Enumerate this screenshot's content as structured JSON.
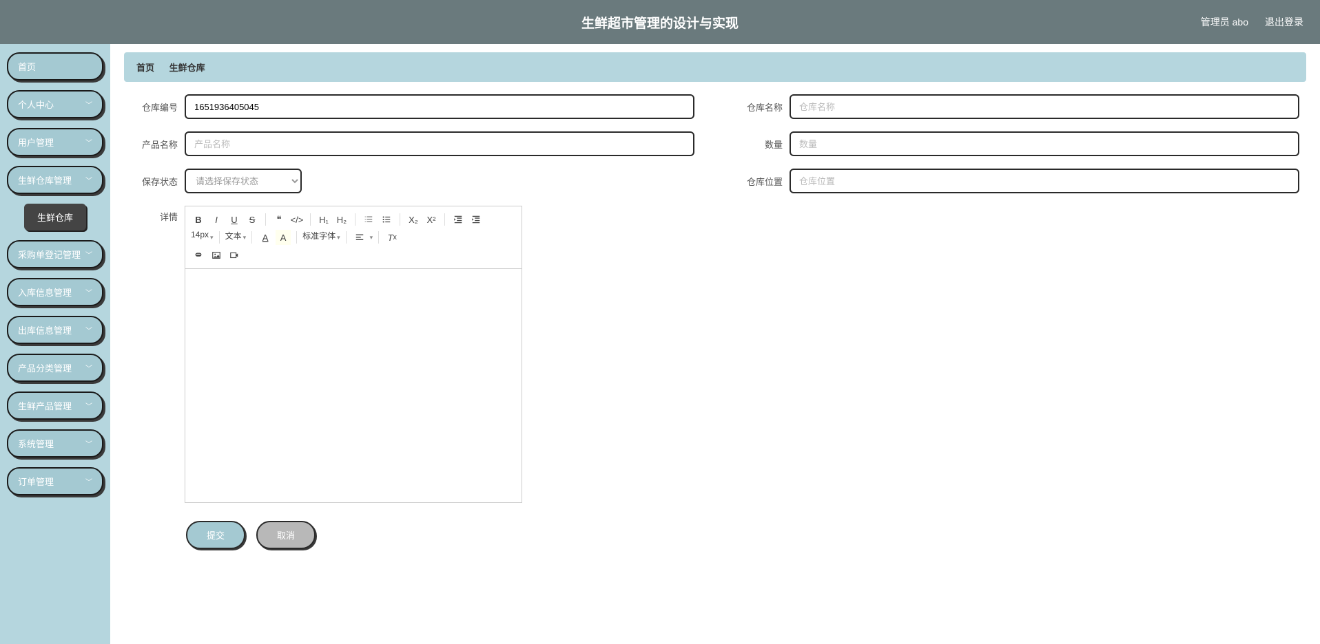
{
  "header": {
    "title": "生鲜超市管理的设计与实现",
    "user_label": "管理员 abo",
    "logout_label": "退出登录"
  },
  "sidebar": {
    "items": [
      {
        "label": "首页",
        "expandable": false
      },
      {
        "label": "个人中心",
        "expandable": true
      },
      {
        "label": "用户管理",
        "expandable": true
      },
      {
        "label": "生鲜仓库管理",
        "expandable": true,
        "active": true
      },
      {
        "label": "采购单登记管理",
        "expandable": true
      },
      {
        "label": "入库信息管理",
        "expandable": true
      },
      {
        "label": "出库信息管理",
        "expandable": true
      },
      {
        "label": "产品分类管理",
        "expandable": true
      },
      {
        "label": "生鲜产品管理",
        "expandable": true
      },
      {
        "label": "系统管理",
        "expandable": true
      },
      {
        "label": "订单管理",
        "expandable": true
      }
    ],
    "subitem_label": "生鲜仓库"
  },
  "breadcrumb": {
    "home": "首页",
    "current": "生鲜仓库"
  },
  "form": {
    "warehouse_no": {
      "label": "仓库编号",
      "value": "1651936405045"
    },
    "warehouse_name": {
      "label": "仓库名称",
      "placeholder": "仓库名称"
    },
    "product_name": {
      "label": "产品名称",
      "placeholder": "产品名称"
    },
    "quantity": {
      "label": "数量",
      "placeholder": "数量"
    },
    "storage_state": {
      "label": "保存状态",
      "placeholder": "请选择保存状态"
    },
    "warehouse_location": {
      "label": "仓库位置",
      "placeholder": "仓库位置"
    },
    "detail": {
      "label": "详情"
    }
  },
  "editor": {
    "font_size": "14px",
    "font_style": "文本",
    "font_family": "标准字体"
  },
  "buttons": {
    "submit": "提交",
    "cancel": "取消"
  }
}
